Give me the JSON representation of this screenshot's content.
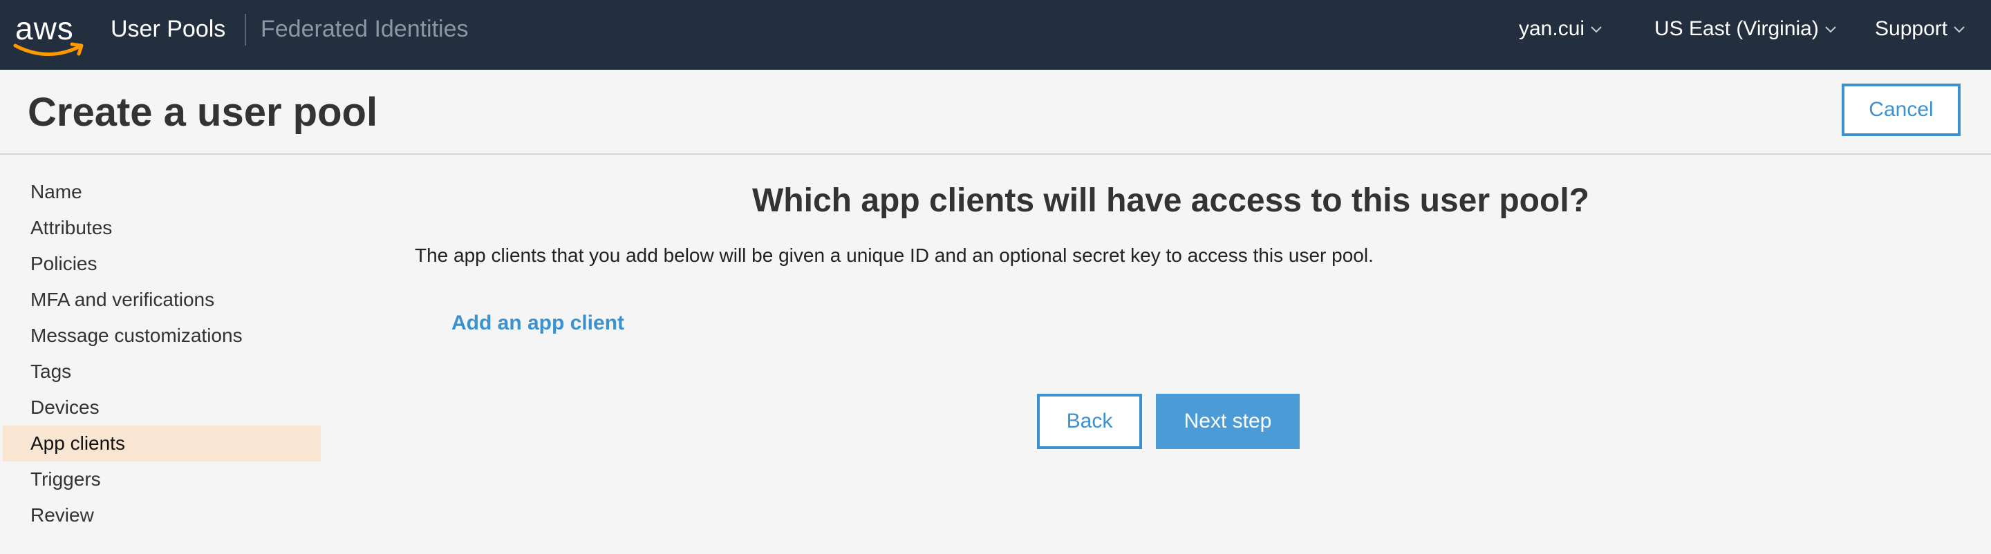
{
  "topbar": {
    "logo_text": "aws",
    "user_pools": "User Pools",
    "federated_identities": "Federated Identities",
    "user": "yan.cui",
    "region": "US East (Virginia)",
    "support": "Support"
  },
  "header": {
    "title": "Create a user pool",
    "cancel_label": "Cancel"
  },
  "sidebar": {
    "items": [
      {
        "label": "Name"
      },
      {
        "label": "Attributes"
      },
      {
        "label": "Policies"
      },
      {
        "label": "MFA and verifications"
      },
      {
        "label": "Message customizations"
      },
      {
        "label": "Tags"
      },
      {
        "label": "Devices"
      },
      {
        "label": "App clients",
        "active": true
      },
      {
        "label": "Triggers"
      },
      {
        "label": "Review"
      }
    ]
  },
  "main": {
    "heading": "Which app clients will have access to this user pool?",
    "description": "The app clients that you add below will be given a unique ID and an optional secret key to access this user pool.",
    "add_link": "Add an app client",
    "back_label": "Back",
    "next_label": "Next step"
  },
  "colors": {
    "topbar_bg": "#232f3e",
    "accent": "#3c91cf",
    "active_item_bg": "#f8e6d3",
    "aws_orange": "#ff9900"
  }
}
